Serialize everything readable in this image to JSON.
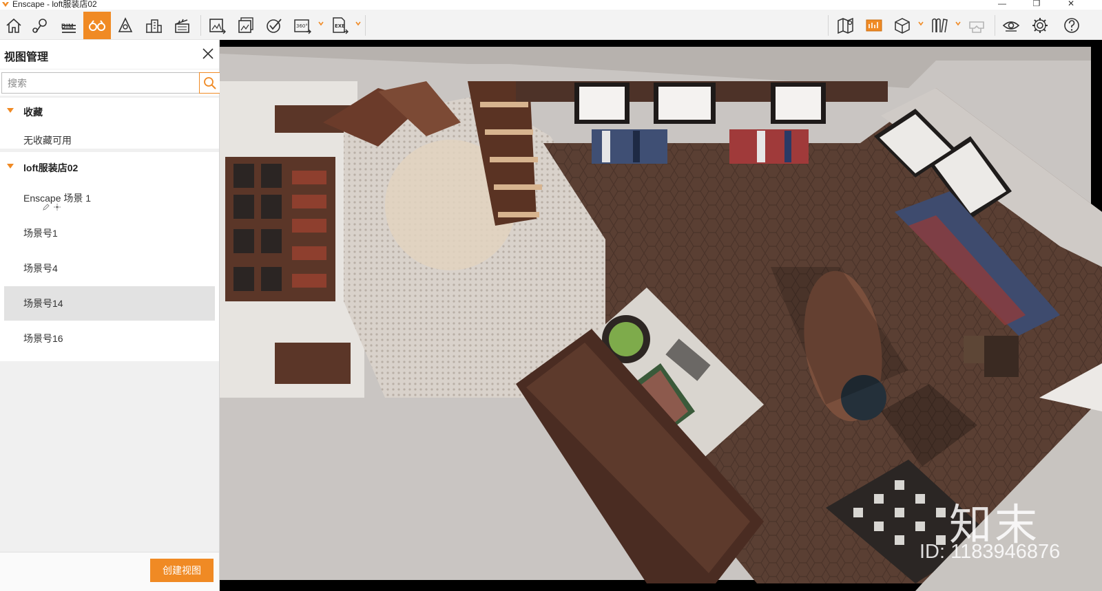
{
  "window": {
    "title": "Enscape - loft服装店02",
    "controls": [
      "minimize-icon",
      "restore-icon",
      "close-icon"
    ]
  },
  "toolbar": {
    "bim_label": "BIM",
    "active_tool": "view-management",
    "accent": "#f08a24",
    "tools": [
      "home-icon",
      "location-pin-icon",
      "bim-icon",
      "binoculars-icon",
      "asset-library-icon",
      "buildings-icon",
      "clapper-icon",
      "screenshot-icon",
      "batch-render-icon",
      "upload-icon",
      "panorama-360-icon",
      "exe-export-icon",
      "map-icon",
      "render-quality-icon",
      "box-icon",
      "library-icon",
      "vr-headset-icon",
      "eye-icon",
      "gear-icon",
      "help-icon"
    ]
  },
  "panel": {
    "title": "视图管理",
    "search_placeholder": "搜索",
    "favorites": {
      "label": "收藏",
      "empty": "无收藏可用"
    },
    "project": {
      "label": "loft服装店02",
      "views": [
        "Enscape 场景 1",
        "场景号1",
        "场景号4",
        "场景号14",
        "场景号16"
      ],
      "selected": "场景号14"
    },
    "create_button": "创建视图"
  },
  "watermark": {
    "brand": "知末",
    "id": "ID: 1183946876"
  }
}
